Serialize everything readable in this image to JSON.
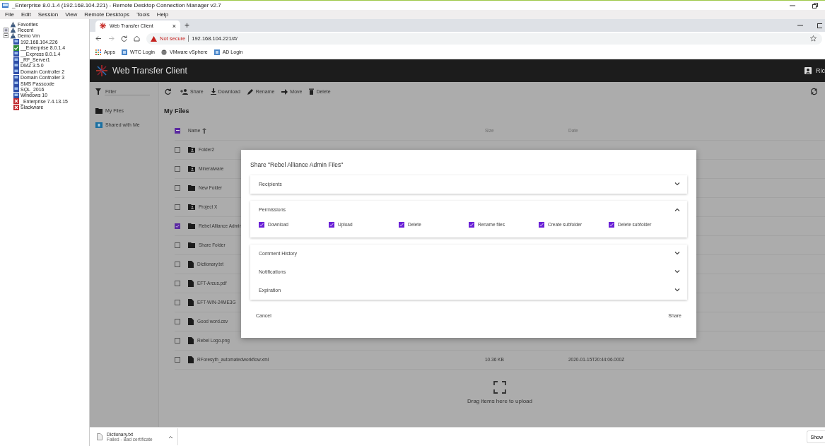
{
  "window": {
    "title": "_Enterprise 8.0.1.4 (192.168.104.221) - Remote Desktop Connection Manager v2.7",
    "menu": [
      "File",
      "Edit",
      "Session",
      "View",
      "Remote Desktops",
      "Tools",
      "Help"
    ]
  },
  "tree": [
    {
      "label": "Favorites"
    },
    {
      "label": "Recent",
      "expanded": false
    },
    {
      "label": "Demo Vm",
      "expanded": true,
      "children": [
        {
          "label": "192.168.104.226",
          "kind": "computer"
        },
        {
          "label": "__Enterprise 8.0.1.4",
          "kind": "connected"
        },
        {
          "label": "__Express 8.0.1.4",
          "kind": "computer"
        },
        {
          "label": "_RF_Server1",
          "kind": "computer"
        },
        {
          "label": "DMZ 3.5.0",
          "kind": "computer"
        },
        {
          "label": "Domain Controller 2",
          "kind": "computer"
        },
        {
          "label": "Domain Controller 3",
          "kind": "computer"
        },
        {
          "label": "SMS Passcode",
          "kind": "computer"
        },
        {
          "label": "SQL_2016",
          "kind": "computer"
        },
        {
          "label": "Windows 10",
          "kind": "computer"
        },
        {
          "label": "_Enterprise 7.4.13.15",
          "kind": "error"
        },
        {
          "label": "Slackware",
          "kind": "error"
        }
      ]
    }
  ],
  "browser": {
    "tab": {
      "title": "Web Transfer Client",
      "close": "×",
      "new": "+"
    },
    "address": {
      "warning": "Not secure",
      "url": "192.168.104.221/#/"
    },
    "bookmarks": [
      {
        "label": "Apps",
        "kind": "apps"
      },
      {
        "label": "WTC Login",
        "kind": "page"
      },
      {
        "label": "VMware vSphere",
        "kind": "globe"
      },
      {
        "label": "AD Login",
        "kind": "page"
      }
    ]
  },
  "app": {
    "title": "Web Transfer Client",
    "user": "Ric",
    "filter": {
      "placeholder": "Filter"
    },
    "nav": [
      {
        "label": "My Files",
        "kind": "folder"
      },
      {
        "label": "Shared with Me",
        "kind": "shared"
      }
    ],
    "toolbar": [
      {
        "label": "Share",
        "kind": "share"
      },
      {
        "label": "Download",
        "kind": "download"
      },
      {
        "label": "Rename",
        "kind": "rename"
      },
      {
        "label": "Move",
        "kind": "move"
      },
      {
        "label": "Delete",
        "kind": "delete"
      }
    ],
    "heading": "My Files",
    "select_all": {
      "indeterminate": true
    },
    "columns": [
      {
        "label": "Name",
        "sorted": true
      },
      {
        "label": "Size",
        "sorted": false
      },
      {
        "label": "Date",
        "sorted": false
      }
    ],
    "rows": [
      {
        "name": "Folder2",
        "kind": "shared-folder",
        "checked": false
      },
      {
        "name": "Mineralware",
        "kind": "shared-folder",
        "checked": false
      },
      {
        "name": "New Folder",
        "kind": "folder",
        "checked": false
      },
      {
        "name": "Project X",
        "kind": "shared-folder",
        "checked": false
      },
      {
        "name": "Rebel Alliance Admin",
        "kind": "folder",
        "checked": true
      },
      {
        "name": "Share Folder",
        "kind": "folder",
        "checked": false
      },
      {
        "name": "Dictionary.txt",
        "kind": "file",
        "checked": false
      },
      {
        "name": "EFT-Arcus.pdf",
        "kind": "file",
        "checked": false
      },
      {
        "name": "EFT-WIN-24ME3G",
        "kind": "file",
        "checked": false
      },
      {
        "name": "Good word.csv",
        "kind": "file",
        "checked": false
      },
      {
        "name": "Rebel Logo.png",
        "kind": "file",
        "checked": false
      },
      {
        "name": "RForesyth_automatedworkflow.xml",
        "kind": "file",
        "checked": false,
        "size": "10.36 KB",
        "date": "2020-01-15T20:44:06.000Z"
      }
    ],
    "dropzone": "Drag items here to upload"
  },
  "dialog": {
    "title": "Share \"Rebel Alliance Admin Files\"",
    "cards": [
      {
        "sections": [
          {
            "title": "Recipients",
            "expanded": false
          }
        ]
      },
      {
        "sections": [
          {
            "title": "Permissions",
            "expanded": true,
            "permissions": [
              {
                "label": "Download",
                "checked": true
              },
              {
                "label": "Upload",
                "checked": true
              },
              {
                "label": "Delete",
                "checked": true
              },
              {
                "label": "Rename files",
                "checked": true
              },
              {
                "label": "Create subfolder",
                "checked": true
              },
              {
                "label": "Delete subfolder",
                "checked": true
              }
            ]
          }
        ]
      },
      {
        "sections": [
          {
            "title": "Comment History",
            "expanded": false
          },
          {
            "title": "Notifications",
            "expanded": false
          },
          {
            "title": "Expiration",
            "expanded": false
          }
        ]
      }
    ],
    "buttons": [
      {
        "label": "Cancel"
      },
      {
        "label": "Share"
      }
    ]
  },
  "download": {
    "file": "Dictionary.txt",
    "status": "Failed - Bad certificate",
    "show": "Show"
  }
}
